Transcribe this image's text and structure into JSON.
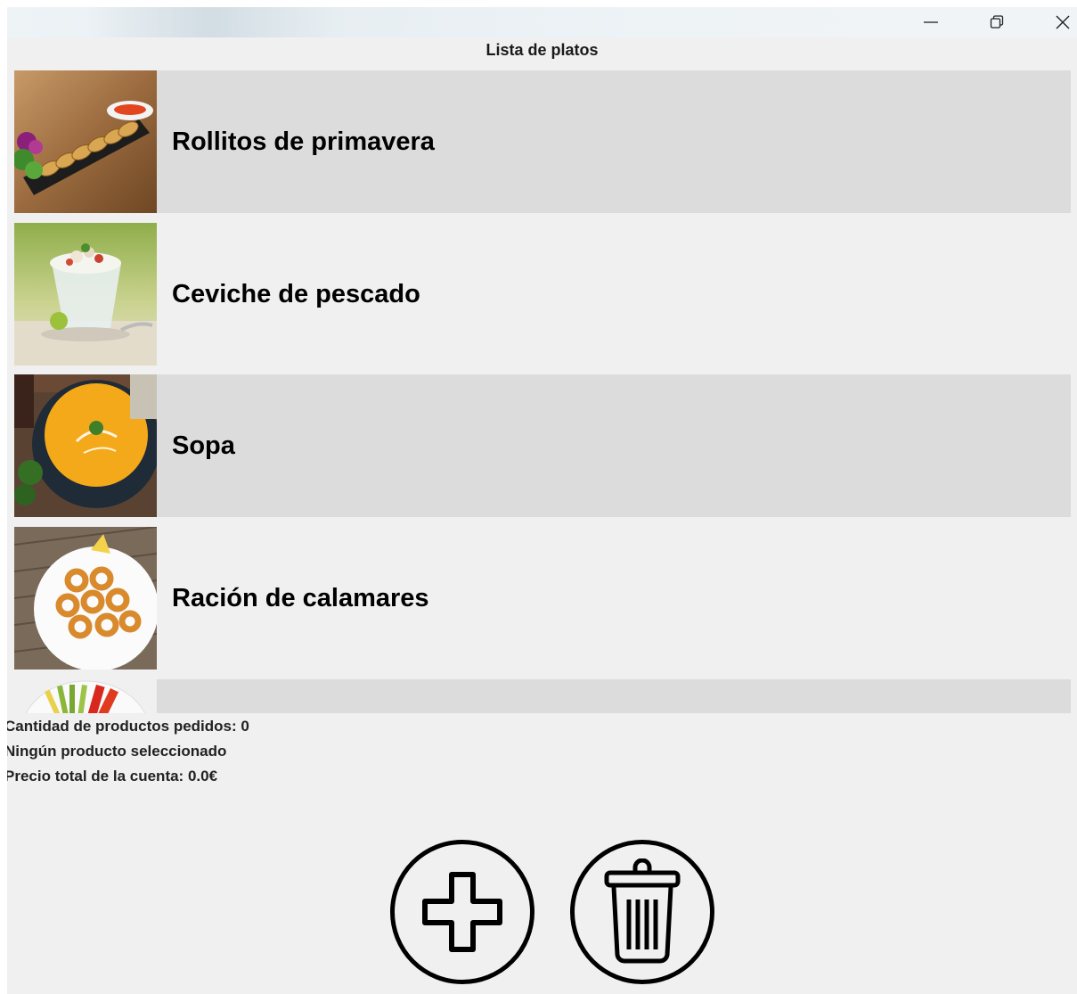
{
  "window": {
    "controls": {
      "minimize_icon": "minimize-icon",
      "maximize_icon": "restore-icon",
      "close_icon": "close-icon"
    }
  },
  "header": {
    "title": "Lista de platos"
  },
  "dishes": [
    {
      "name": "Rollitos de primavera",
      "image": "spring-rolls-photo",
      "shaded": true
    },
    {
      "name": "Ceviche de pescado",
      "image": "ceviche-photo",
      "shaded": false
    },
    {
      "name": "Sopa",
      "image": "soup-photo",
      "shaded": true
    },
    {
      "name": "Ración de calamares",
      "image": "calamari-photo",
      "shaded": false
    },
    {
      "name": "",
      "image": "vegetables-photo",
      "shaded": true
    }
  ],
  "summary": {
    "quantity": "Cantidad de productos pedidos: 0",
    "selection": "Ningún producto seleccionado",
    "total": "Precio total de la cuenta: 0.0€"
  },
  "actions": {
    "add_icon": "plus-icon",
    "delete_icon": "trash-icon"
  },
  "colors": {
    "background": "#f0f0f0",
    "row_shaded": "#dcdcdc",
    "text": "#000000"
  }
}
